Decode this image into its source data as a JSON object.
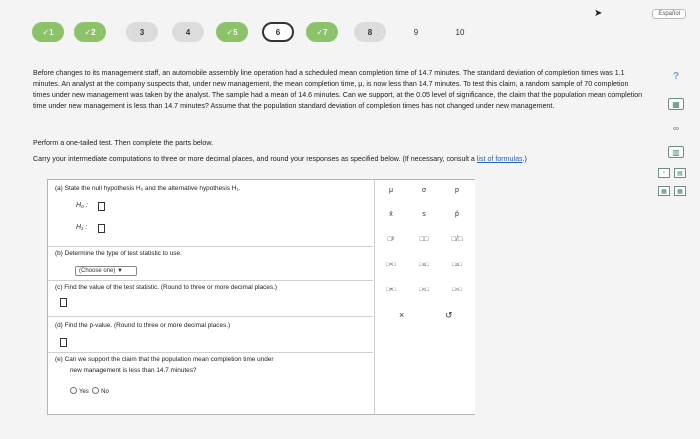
{
  "header": {
    "language_button": "Español",
    "steps": [
      {
        "label": "✓1",
        "state": "done"
      },
      {
        "label": "✓2",
        "state": "done"
      },
      {
        "label": "3",
        "state": "todo"
      },
      {
        "label": "4",
        "state": "todo"
      },
      {
        "label": "✓5",
        "state": "done"
      },
      {
        "label": "6",
        "state": "current"
      },
      {
        "label": "✓7",
        "state": "done"
      },
      {
        "label": "8",
        "state": "todo"
      },
      {
        "label": "9",
        "state": "plain"
      },
      {
        "label": "10",
        "state": "plain"
      }
    ]
  },
  "problem": {
    "text": "Before changes to its management staff, an automobile assembly line operation had a scheduled mean completion time of 14.7 minutes. The standard deviation of completion times was 1.1 minutes. An analyst at the company suspects that, under new management, the mean completion time, μ, is now less than 14.7 minutes. To test this claim, a random sample of 70 completion times under new management was taken by the analyst. The sample had a mean of 14.6 minutes. Can we support, at the 0.05 level of significance, the claim that the population mean completion time under new management is less than 14.7 minutes? Assume that the population standard deviation of completion times has not changed under new management.",
    "instruction": "Perform a one-tailed test. Then complete the parts below.",
    "carry_prefix": "Carry your intermediate computations to three or more decimal places, and round your responses as specified below. (If necessary, consult a ",
    "carry_link": "list of formulas",
    "carry_suffix": ".)"
  },
  "parts": {
    "a_label": "(a)  State the null hypothesis H₀ and the alternative hypothesis H₁.",
    "h0": "H₀ :",
    "h1": "H₁ :",
    "b_label": "(b)  Determine the type of test statistic to use.",
    "b_select": "(Choose one)",
    "c_label": "(c)  Find the value of the test statistic. (Round to three or more decimal places.)",
    "d_label": "(d)  Find the p-value. (Round to three or more decimal places.)",
    "e_label_1": "(e)  Can we support the claim that the population mean completion time under",
    "e_label_2": "new management is less than 14.7 minutes?",
    "e_yes": "Yes",
    "e_no": "No"
  },
  "palette": {
    "row1": [
      "μ",
      "σ",
      "p"
    ],
    "row2": [
      "x̄",
      "s",
      "p̂"
    ],
    "row3": [
      "□ᵖ",
      "□□",
      "□/□"
    ],
    "row4": [
      "□=□",
      "□≤□",
      "□≥□"
    ],
    "row5": [
      "□≠□",
      "□<□",
      "□>□"
    ],
    "clear": "×",
    "undo": "↺"
  },
  "sidebar": {
    "help": "?"
  }
}
